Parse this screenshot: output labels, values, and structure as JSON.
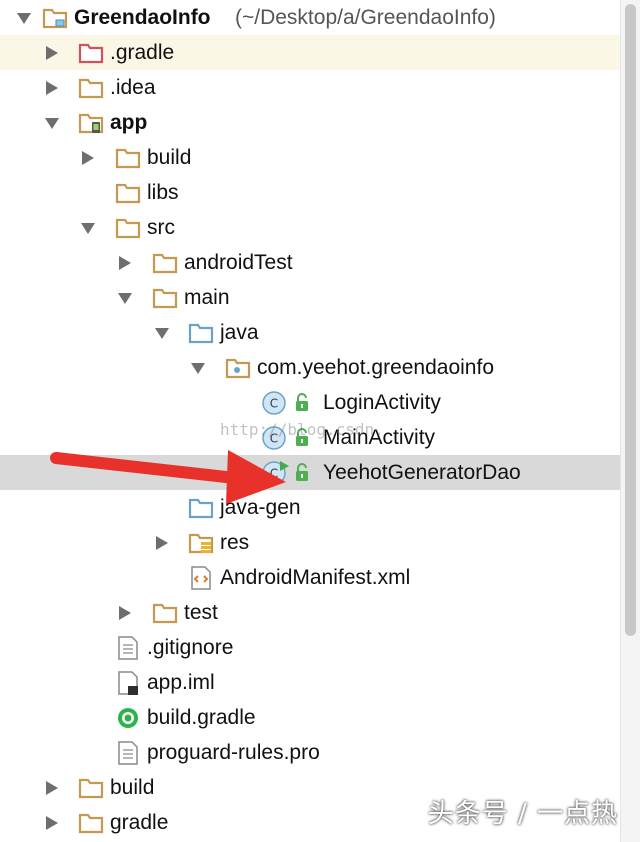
{
  "project": {
    "name": "GreendaoInfo",
    "path": "(~/Desktop/a/GreendaoInfo)"
  },
  "tree": [
    {
      "label": "GreendaoInfo",
      "icon": "project-folder-icon"
    },
    {
      "label": ".gradle",
      "icon": "folder-icon"
    },
    {
      "label": ".idea",
      "icon": "folder-icon"
    },
    {
      "label": "app",
      "icon": "android-module-folder-icon"
    },
    {
      "label": "build",
      "icon": "folder-icon"
    },
    {
      "label": "libs",
      "icon": "folder-icon"
    },
    {
      "label": "src",
      "icon": "folder-icon"
    },
    {
      "label": "androidTest",
      "icon": "folder-icon"
    },
    {
      "label": "main",
      "icon": "folder-icon"
    },
    {
      "label": "java",
      "icon": "source-folder-icon"
    },
    {
      "label": "com.yeehot.greendaoinfo",
      "icon": "package-folder-icon"
    },
    {
      "label": "LoginActivity",
      "icon": "java-class-icon"
    },
    {
      "label": "MainActivity",
      "icon": "java-class-icon"
    },
    {
      "label": "YeehotGeneratorDao",
      "icon": "java-runnable-class-icon"
    },
    {
      "label": "java-gen",
      "icon": "source-folder-icon"
    },
    {
      "label": "res",
      "icon": "resources-folder-icon"
    },
    {
      "label": "AndroidManifest.xml",
      "icon": "xml-file-icon"
    },
    {
      "label": "test",
      "icon": "folder-icon"
    },
    {
      "label": ".gitignore",
      "icon": "text-file-icon"
    },
    {
      "label": "app.iml",
      "icon": "iml-file-icon"
    },
    {
      "label": "build.gradle",
      "icon": "gradle-file-icon"
    },
    {
      "label": "proguard-rules.pro",
      "icon": "text-file-icon"
    },
    {
      "label": "build",
      "icon": "folder-icon"
    },
    {
      "label": "gradle",
      "icon": "folder-icon"
    }
  ],
  "watermark": "http://blog.csdn.",
  "brand": "头条号 / 一点热",
  "colors": {
    "highlight_row": "#fbf7e6",
    "selected_row": "#d9d9d9",
    "folder": "#c49a52",
    "source_folder": "#6aa2c8",
    "class_badge": "#8ec6ea",
    "lock_badge": "#4caf50",
    "annotation_arrow": "#e8312a"
  }
}
